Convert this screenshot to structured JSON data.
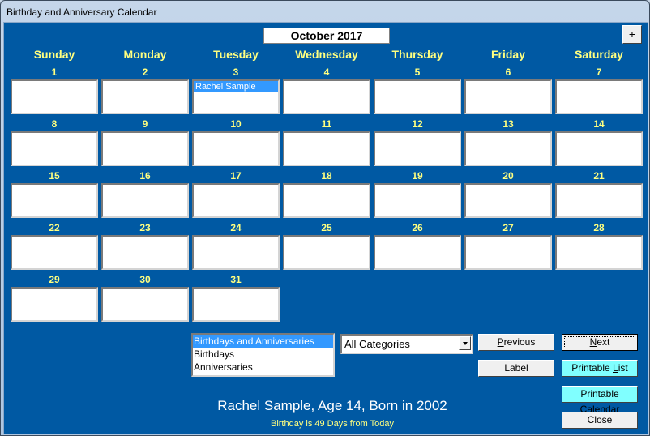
{
  "window": {
    "title": "Birthday and Anniversary Calendar"
  },
  "header": {
    "month_title": "October 2017",
    "plus_label": "+"
  },
  "weekdays": [
    "Sunday",
    "Monday",
    "Tuesday",
    "Wednesday",
    "Thursday",
    "Friday",
    "Saturday"
  ],
  "calendar": {
    "days": [
      {
        "day": "1",
        "entries": []
      },
      {
        "day": "2",
        "entries": []
      },
      {
        "day": "3",
        "entries": [
          "Rachel Sample"
        ]
      },
      {
        "day": "4",
        "entries": []
      },
      {
        "day": "5",
        "entries": []
      },
      {
        "day": "6",
        "entries": []
      },
      {
        "day": "7",
        "entries": []
      },
      {
        "day": "8",
        "entries": []
      },
      {
        "day": "9",
        "entries": []
      },
      {
        "day": "10",
        "entries": []
      },
      {
        "day": "11",
        "entries": []
      },
      {
        "day": "12",
        "entries": []
      },
      {
        "day": "13",
        "entries": []
      },
      {
        "day": "14",
        "entries": []
      },
      {
        "day": "15",
        "entries": []
      },
      {
        "day": "16",
        "entries": []
      },
      {
        "day": "17",
        "entries": []
      },
      {
        "day": "18",
        "entries": []
      },
      {
        "day": "19",
        "entries": []
      },
      {
        "day": "20",
        "entries": []
      },
      {
        "day": "21",
        "entries": []
      },
      {
        "day": "22",
        "entries": []
      },
      {
        "day": "23",
        "entries": []
      },
      {
        "day": "24",
        "entries": []
      },
      {
        "day": "25",
        "entries": []
      },
      {
        "day": "26",
        "entries": []
      },
      {
        "day": "27",
        "entries": []
      },
      {
        "day": "28",
        "entries": []
      },
      {
        "day": "29",
        "entries": []
      },
      {
        "day": "30",
        "entries": []
      },
      {
        "day": "31",
        "entries": []
      }
    ]
  },
  "type_list": {
    "items": [
      "Birthdays and Anniversaries",
      "Birthdays",
      "Anniversaries"
    ],
    "selected": 0
  },
  "category_combo": {
    "value": "All Categories"
  },
  "buttons": {
    "previous": {
      "pre": "",
      "u": "P",
      "post": "revious"
    },
    "next": {
      "pre": "",
      "u": "N",
      "post": "ext"
    },
    "label": {
      "pre": "Label",
      "u": "",
      "post": ""
    },
    "printable_list": {
      "pre": "Printable ",
      "u": "L",
      "post": "ist"
    },
    "printable_calendar": {
      "pre": "Printable ",
      "u": "C",
      "post": "alendar"
    },
    "close": {
      "pre": "Close",
      "u": "",
      "post": ""
    }
  },
  "status": {
    "person": "Rachel Sample, Age 14, Born in 2002",
    "days_away": "Birthday is 49 Days from Today"
  },
  "colors": {
    "background": "#0059a3",
    "day_label": "#ffff80",
    "selection": "#3399ff",
    "highlight_button": "#80ffff"
  }
}
